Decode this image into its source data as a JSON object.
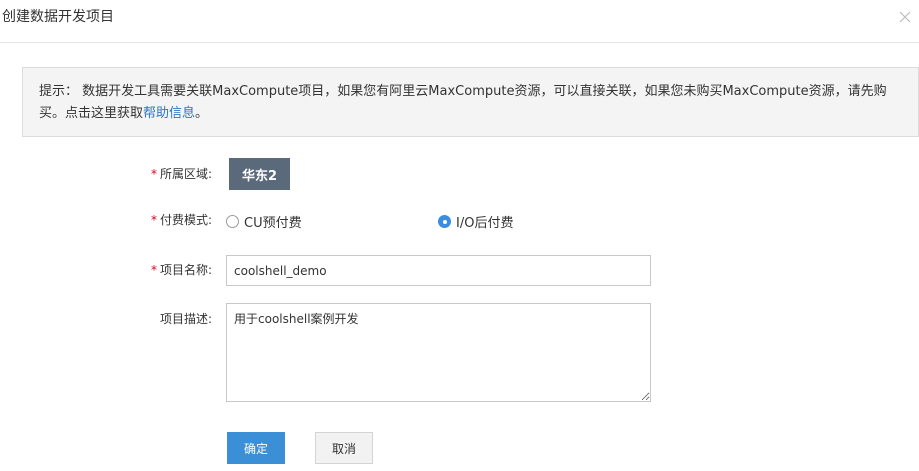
{
  "dialog": {
    "title": "创建数据开发项目"
  },
  "notice": {
    "text": "提示：  数据开发工具需要关联MaxCompute项目，如果您有阿里云MaxCompute资源，可以直接关联，如果您未购买MaxCompute资源，请先购买。点击这里获取",
    "link": "帮助信息",
    "suffix": "。"
  },
  "form": {
    "required_mark": "*",
    "region": {
      "label": "所属区域:",
      "value": "华东2"
    },
    "billing": {
      "label": "付费模式:",
      "options": [
        {
          "label": "CU预付费",
          "selected": false
        },
        {
          "label": "I/O后付费",
          "selected": true
        }
      ]
    },
    "project_name": {
      "label": "项目名称:",
      "value": "coolshell_demo"
    },
    "project_desc": {
      "label": "项目描述:",
      "value": "用于coolshell案例开发"
    }
  },
  "buttons": {
    "ok": "确定",
    "cancel": "取消"
  },
  "colors": {
    "accent": "#3a8fd6",
    "link": "#2f73c9",
    "required": "#d9001b",
    "region_button": "#5b6a7a"
  }
}
